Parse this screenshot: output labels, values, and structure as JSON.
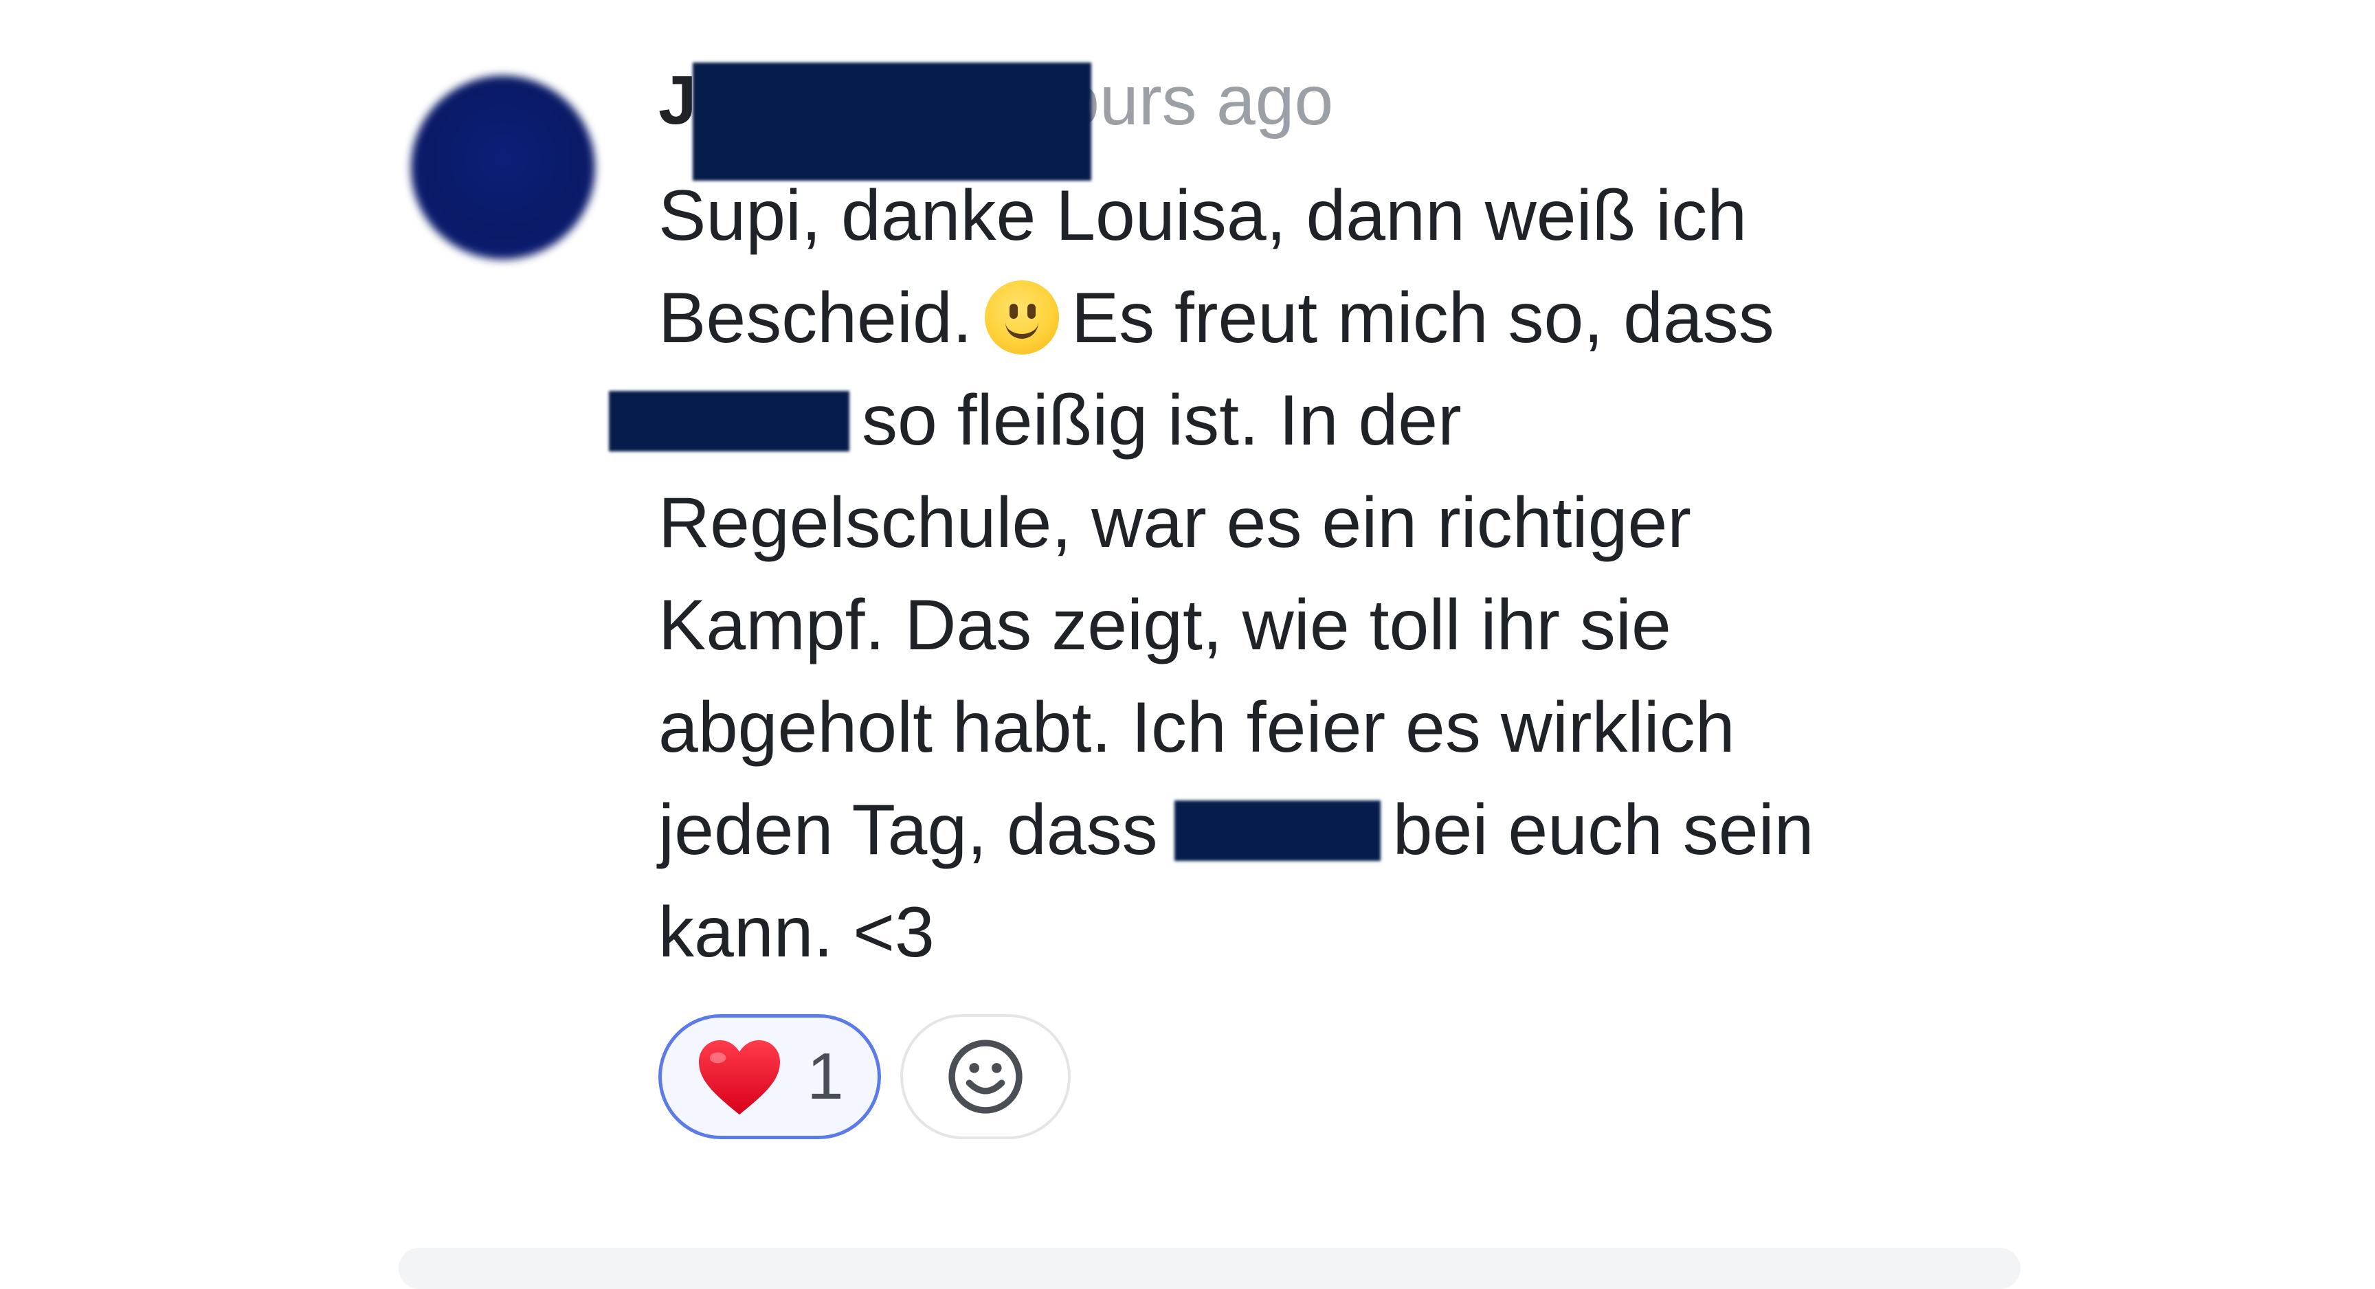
{
  "comment": {
    "author_visible": "J          z",
    "timestamp": "2 hours ago",
    "body_lines": {
      "l1": "Supi, danke Louisa, dann weiß ich",
      "l2a": "Bescheid.",
      "l2b": "Es freut mich so, dass",
      "l3": "so fleißig ist. In der",
      "l4": "Regelschule, war es ein richtiger",
      "l5": "Kampf. Das zeigt, wie toll ihr sie",
      "l6": "abgeholt habt. Ich feier es wirklich",
      "l7a": "jeden Tag, dass",
      "l7b": "bei euch sein",
      "l8": "kann. <3"
    },
    "reactions": [
      {
        "emoji": "heart-icon",
        "count": "1",
        "active": true
      },
      {
        "emoji": "add-reaction-smiley-icon"
      }
    ]
  },
  "colors": {
    "redaction": "#061c4a",
    "accent_border": "#5b7be8",
    "timestamp": "#9aa0a6",
    "text": "#1f2328"
  }
}
